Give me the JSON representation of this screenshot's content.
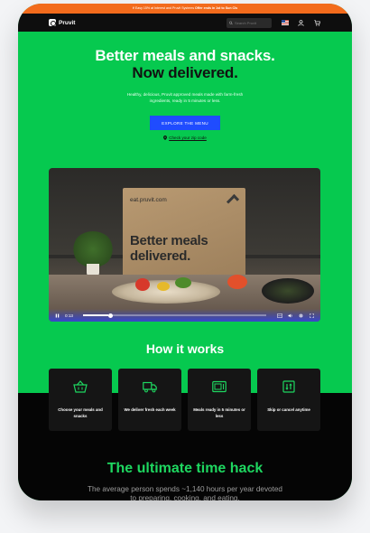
{
  "promo": {
    "text": "¥ Easy 15% at Interest and Pruvit Systems ",
    "bold": "Offer ends in 1st to Sun Cls"
  },
  "nav": {
    "logo": "Pruvit",
    "search_placeholder": "Search Pruvit"
  },
  "hero": {
    "headline_1": "Better meals and snacks.",
    "headline_2": "Now delivered.",
    "subtext": "Healthy, delicious, Pruvit approved meals made with farm-fresh ingredients, ready in 5 minutes or less.",
    "cta_label": "EXPLORE THE MENU",
    "zip_link": "Check your zip code"
  },
  "video": {
    "box_url": "eat.pruvit.com",
    "box_line_1": "Better meals",
    "box_line_2": "delivered.",
    "time": "0:13",
    "progress_fraction": 0.14
  },
  "how_it_works": {
    "title": "How it works",
    "cards": [
      {
        "icon": "basket-icon",
        "label": "Choose your meals and snacks"
      },
      {
        "icon": "truck-icon",
        "label": "We deliver fresh each week"
      },
      {
        "icon": "microwave-icon",
        "label": "Meals ready in 5 minutes or less"
      },
      {
        "icon": "calendar-icon",
        "label": "Skip or cancel anytime"
      }
    ]
  },
  "time_hack": {
    "title": "The ultimate time hack",
    "text": "The average person spends ~1,140 hours per year devoted to preparing, cooking, and eating."
  },
  "colors": {
    "brand_green": "#06c94f",
    "cta_blue": "#1f4cff",
    "promo_orange": "#f36b1c",
    "accent_green": "#1ed760"
  }
}
